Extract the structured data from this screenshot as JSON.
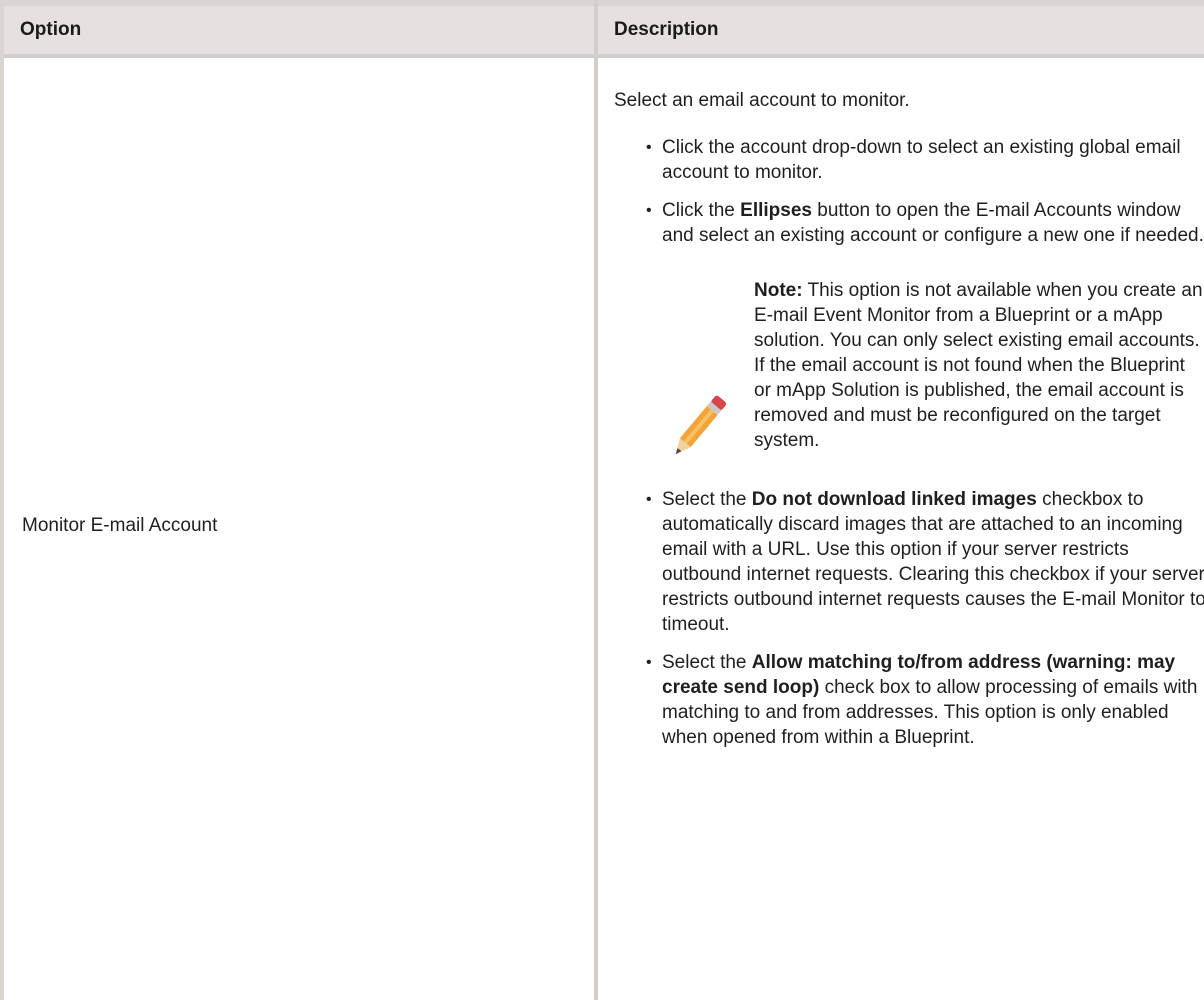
{
  "header": {
    "option": "Option",
    "description": "Description"
  },
  "row": {
    "option": "Monitor E-mail Account",
    "intro": "Select an email account to monitor.",
    "bullet1": "Click the account drop-down to select an existing global email account to monitor.",
    "bullet2_pre": "Click the ",
    "bullet2_bold": "Ellipses",
    "bullet2_post": " button to open the E-mail Accounts window and select an existing account or configure a new one if needed.",
    "note_label": "Note:",
    "note_text": " This option is not available when you create an E-mail Event Monitor from a Blueprint or a mApp solution. You can only select existing email accounts. If the email account is not found when the Blueprint or mApp Solution is published, the email account is removed and must be reconfigured on the target system.",
    "note_icon": "pencil-icon",
    "bullet3_pre": "Select the ",
    "bullet3_bold": "Do not download linked images",
    "bullet3_post": " checkbox to automatically discard images that are attached to an incoming email with a URL. Use this option if your server restricts outbound internet requests. Clearing this checkbox if your server restricts outbound internet requests causes the E-mail Monitor to timeout.",
    "bullet4_pre": "Select the ",
    "bullet4_bold": "Allow matching to/from address (warning: may create send loop)",
    "bullet4_post": " check box to allow processing of emails with matching to and from addresses. This option is only enabled when opened from within a Blueprint."
  }
}
